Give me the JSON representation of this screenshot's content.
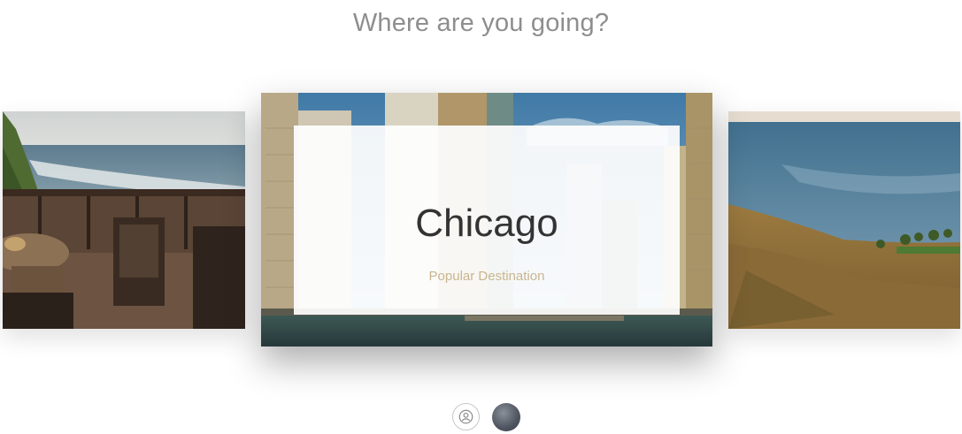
{
  "header": {
    "title": "Where are you going?"
  },
  "carousel": {
    "left_card": {
      "image": "beach-balcony-photo"
    },
    "center_card": {
      "image": "chicago-city-photo",
      "city": "Chicago",
      "subtitle": "Popular Destination"
    },
    "right_card": {
      "image": "coastal-hillside-photo"
    }
  },
  "controls": {
    "user_icon": "user-icon",
    "avatar": "profile-avatar"
  },
  "colors": {
    "title_text": "#8e8e8e",
    "city_text": "#333333",
    "subtitle_text": "#c9b58f"
  }
}
